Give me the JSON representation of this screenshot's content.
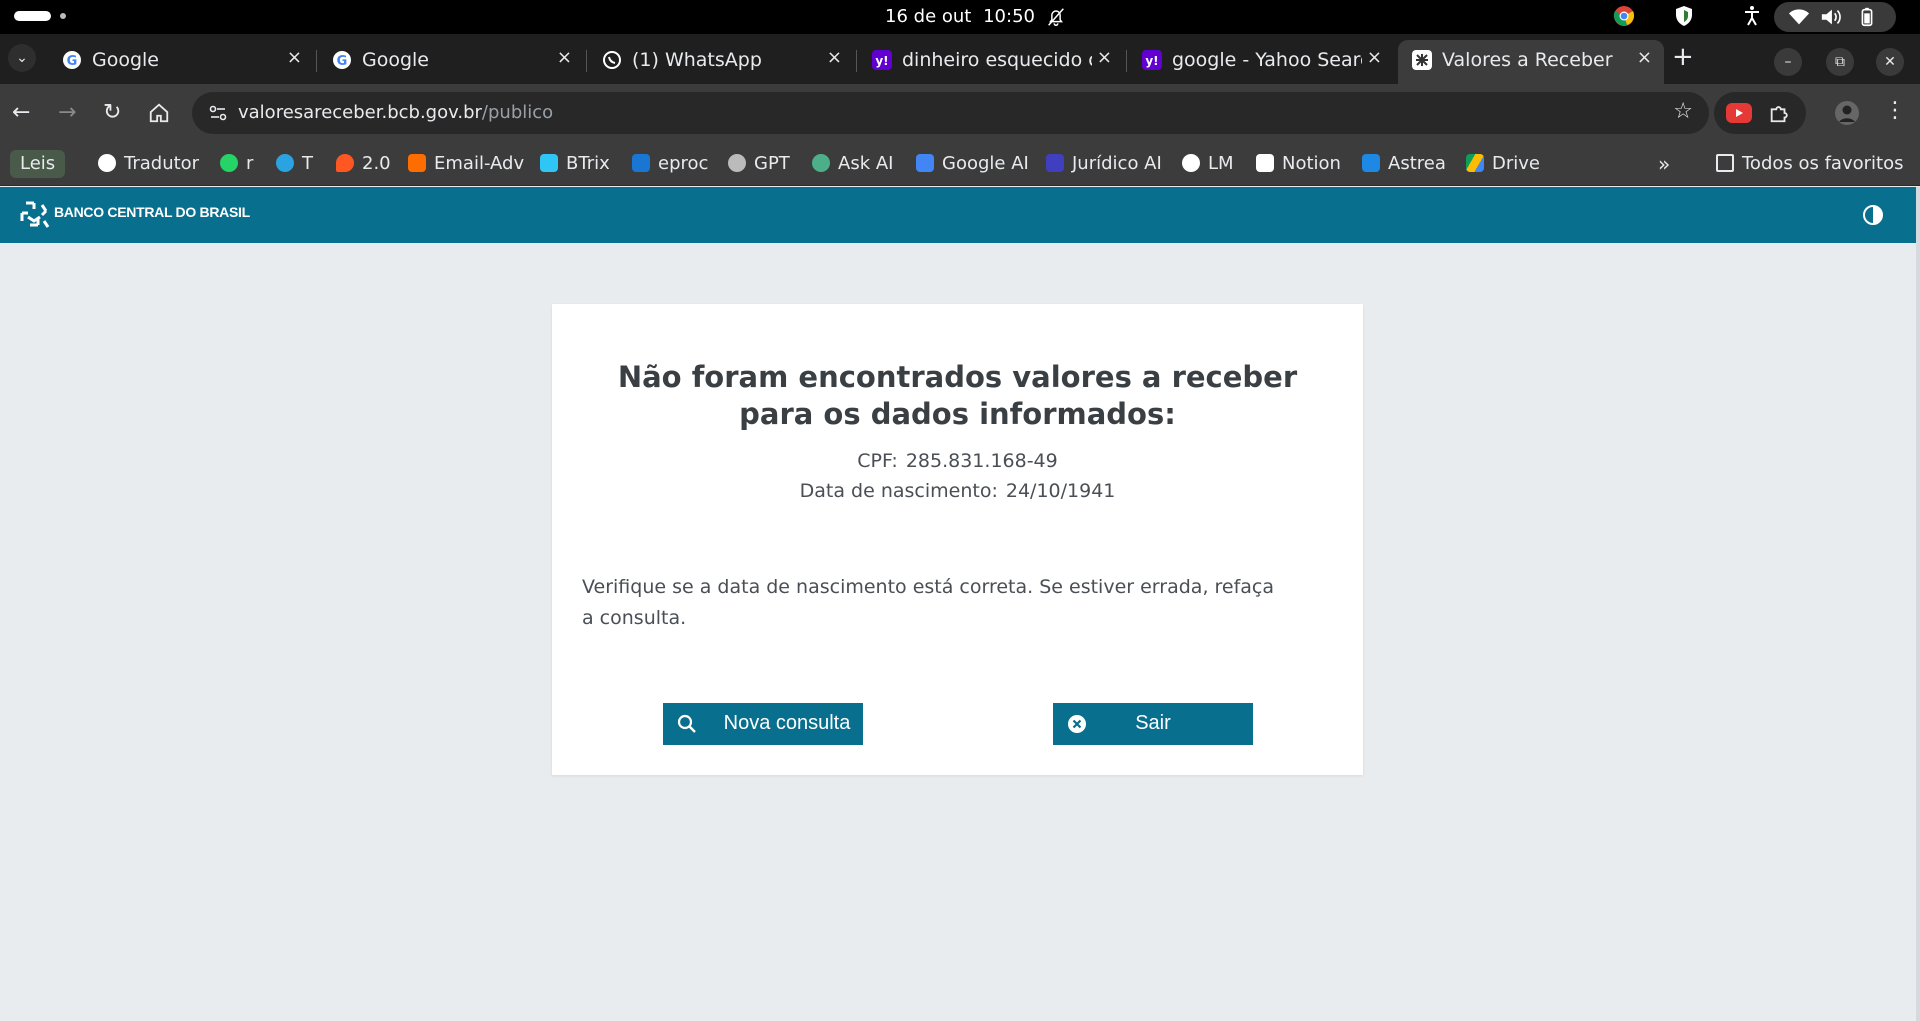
{
  "os": {
    "date": "16 de out",
    "time": "10:50"
  },
  "browser": {
    "tabs": [
      {
        "title": "Google",
        "icon": "google-icon"
      },
      {
        "title": "Google",
        "icon": "google-icon"
      },
      {
        "title": "(1) WhatsApp",
        "icon": "whatsapp-icon"
      },
      {
        "title": "dinheiro esquecido co",
        "icon": "yahoo-icon"
      },
      {
        "title": "google - Yahoo Search",
        "icon": "yahoo-icon"
      },
      {
        "title": "Valores a Receber",
        "icon": "bcb-icon",
        "active": true
      }
    ],
    "tab_close": "×",
    "new_tab": "+",
    "url_host": "valoresareceber.bcb.gov.br",
    "url_path": "/publico",
    "bookmarks": [
      {
        "label": "Leis"
      },
      {
        "label": "Tradutor",
        "icon": "google-icon"
      },
      {
        "label": "r",
        "icon": "whatsapp-icon"
      },
      {
        "label": "T",
        "icon": "telegram-icon"
      },
      {
        "label": "2.0",
        "icon": "fire-icon"
      },
      {
        "label": "Email-Adv",
        "icon": "link-icon"
      },
      {
        "label": "BTrix",
        "icon": "bitrix-icon"
      },
      {
        "label": "eproc",
        "icon": "eproc-icon"
      },
      {
        "label": "GPT",
        "icon": "openai-icon"
      },
      {
        "label": "Ask AI",
        "icon": "askai-icon"
      },
      {
        "label": "Google AI",
        "icon": "googleai-icon"
      },
      {
        "label": "Jurídico AI",
        "icon": "juridico-icon"
      },
      {
        "label": "LM",
        "icon": "lm-icon"
      },
      {
        "label": "Notion",
        "icon": "notion-icon"
      },
      {
        "label": "Astrea",
        "icon": "astrea-icon"
      },
      {
        "label": "Drive",
        "icon": "drive-icon"
      }
    ],
    "more_bookmarks": "»",
    "all_favorites": "Todos os favoritos"
  },
  "site": {
    "brand": "BANCO CENTRAL DO BRASIL",
    "colors": {
      "header": "#086f8e",
      "button": "#086f8e"
    }
  },
  "result": {
    "title": "Não foram encontrados valores a receber para os dados informados:",
    "cpf_label": "CPF:",
    "cpf_value": "285.831.168-49",
    "birth_label": "Data de nascimento:",
    "birth_value": "24/10/1941",
    "message": "Verifique se a data de nascimento está correta. Se estiver errada, refaça a consulta.",
    "new_query_button": "Nova consulta",
    "exit_button": "Sair"
  }
}
